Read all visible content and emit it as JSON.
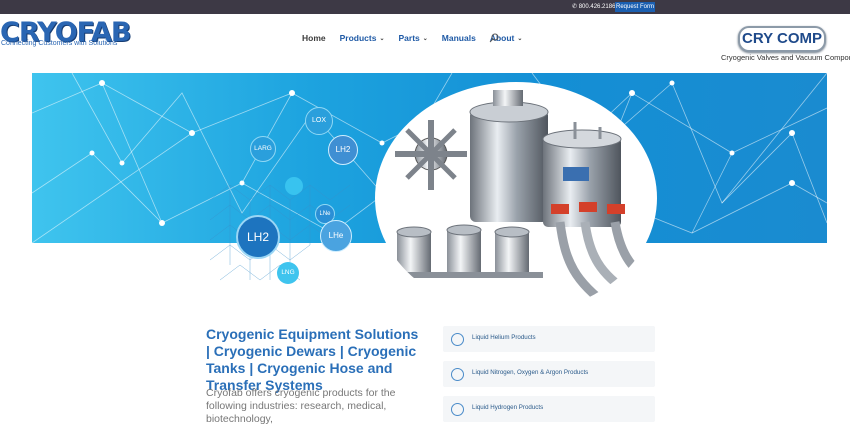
{
  "topbar": {
    "phone": "800.426.2186",
    "request_label": "Request Form"
  },
  "brand": {
    "logo_text": "CRYOFAB",
    "tagline": "Connecting Customers with Solutions"
  },
  "nav": {
    "items": [
      {
        "label": "Home",
        "has_menu": false
      },
      {
        "label": "Products",
        "has_menu": true
      },
      {
        "label": "Parts",
        "has_menu": true
      },
      {
        "label": "Manuals",
        "has_menu": false
      },
      {
        "label": "About",
        "has_menu": true
      }
    ]
  },
  "partner": {
    "logo_text": "CRY COMP",
    "tagline": "Cryogenic Valves and Vacuum Compone"
  },
  "hero": {
    "bubbles": [
      "LOX",
      "LARG",
      "LH2",
      "LH2",
      "LNe",
      "LHe",
      "LNG"
    ]
  },
  "content": {
    "title": "Cryogenic Equipment Solutions | Cryogenic Dewars | Cryogenic Tanks | Cryogenic Hose and Transfer Systems",
    "description": "Cryofab offers cryogenic products for the following industries: research, medical, biotechnology,"
  },
  "products": [
    {
      "label": "Liquid Helium Products"
    },
    {
      "label": "Liquid Nitrogen, Oxygen & Argon Products"
    },
    {
      "label": "Liquid Hydrogen Products"
    }
  ],
  "colors": {
    "brand_blue": "#2a66b3",
    "hero_light": "#3fc4ee",
    "hero_dark": "#148fd5",
    "topbar": "#3d3945"
  }
}
